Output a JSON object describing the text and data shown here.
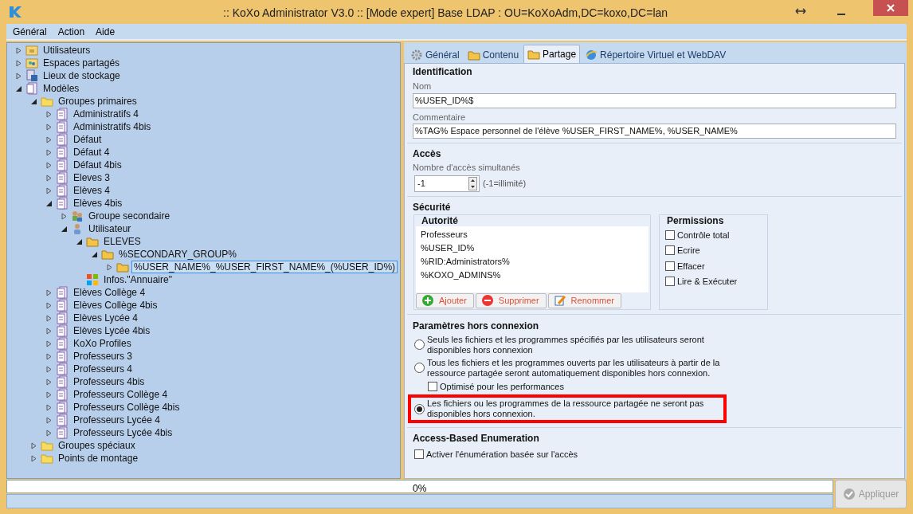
{
  "window": {
    "title": ":: KoXo Administrator V3.0 :: [Mode expert] Base LDAP : OU=KoXoAdm,DC=koxo,DC=lan"
  },
  "menu": [
    "Général",
    "Action",
    "Aide"
  ],
  "tree": [
    {
      "label": "Utilisateurs",
      "kind": "users",
      "expanded": false,
      "selected": false
    },
    {
      "label": "Espaces partagés",
      "kind": "shared",
      "expanded": false,
      "selected": false
    },
    {
      "label": "Lieux de stockage",
      "kind": "storage",
      "expanded": false,
      "selected": false
    },
    {
      "label": "Modèles",
      "kind": "models",
      "expanded": true,
      "selected": false,
      "children": [
        {
          "label": "Groupes primaires",
          "kind": "folder",
          "expanded": true,
          "selected": false,
          "children": [
            {
              "label": "Administratifs 4",
              "kind": "template",
              "expanded": false,
              "selected": false
            },
            {
              "label": "Administratifs 4bis",
              "kind": "template",
              "expanded": false,
              "selected": false
            },
            {
              "label": "Défaut",
              "kind": "template",
              "expanded": false,
              "selected": false
            },
            {
              "label": "Défaut 4",
              "kind": "template",
              "expanded": false,
              "selected": false
            },
            {
              "label": "Défaut 4bis",
              "kind": "template",
              "expanded": false,
              "selected": false
            },
            {
              "label": "Eleves 3",
              "kind": "template",
              "expanded": false,
              "selected": false
            },
            {
              "label": "Elèves 4",
              "kind": "template",
              "expanded": false,
              "selected": false
            },
            {
              "label": "Elèves 4bis",
              "kind": "template",
              "expanded": true,
              "selected": false,
              "children": [
                {
                  "label": "Groupe secondaire",
                  "kind": "group",
                  "expanded": false,
                  "selected": false
                },
                {
                  "label": "Utilisateur",
                  "kind": "user",
                  "expanded": true,
                  "selected": false,
                  "children": [
                    {
                      "label": "ELEVES",
                      "kind": "folder2",
                      "expanded": true,
                      "selected": false,
                      "children": [
                        {
                          "label": "%SECONDARY_GROUP%",
                          "kind": "folder2",
                          "expanded": true,
                          "selected": false,
                          "children": [
                            {
                              "label": "%USER_NAME%_%USER_FIRST_NAME%_(%USER_ID%)",
                              "kind": "folder2",
                              "expanded": false,
                              "selected": true
                            }
                          ]
                        }
                      ]
                    },
                    {
                      "label": "Infos.\"Annuaire\"",
                      "kind": "windows",
                      "selected": false
                    }
                  ]
                }
              ]
            },
            {
              "label": "Elèves Collège 4",
              "kind": "template",
              "expanded": false,
              "selected": false
            },
            {
              "label": "Elèves Collège 4bis",
              "kind": "template",
              "expanded": false,
              "selected": false
            },
            {
              "label": "Elèves Lycée 4",
              "kind": "template",
              "expanded": false,
              "selected": false
            },
            {
              "label": "Elèves Lycée 4bis",
              "kind": "template",
              "expanded": false,
              "selected": false
            },
            {
              "label": "KoXo Profiles",
              "kind": "template",
              "expanded": false,
              "selected": false
            },
            {
              "label": "Professeurs 3",
              "kind": "template",
              "expanded": false,
              "selected": false
            },
            {
              "label": "Professeurs 4",
              "kind": "template",
              "expanded": false,
              "selected": false
            },
            {
              "label": "Professeurs 4bis",
              "kind": "template",
              "expanded": false,
              "selected": false
            },
            {
              "label": "Professeurs Collège 4",
              "kind": "template",
              "expanded": false,
              "selected": false
            },
            {
              "label": "Professeurs Collège 4bis",
              "kind": "template",
              "expanded": false,
              "selected": false
            },
            {
              "label": "Professeurs Lycée 4",
              "kind": "template",
              "expanded": false,
              "selected": false
            },
            {
              "label": "Professeurs Lycée 4bis",
              "kind": "template",
              "expanded": false,
              "selected": false
            }
          ]
        },
        {
          "label": "Groupes spéciaux",
          "kind": "folder",
          "expanded": false,
          "selected": false
        },
        {
          "label": "Points de montage",
          "kind": "folder",
          "expanded": false,
          "selected": false
        }
      ]
    }
  ],
  "tabs": [
    {
      "label": "Général",
      "kind": "gear",
      "selected": false
    },
    {
      "label": "Contenu",
      "kind": "folder",
      "selected": false
    },
    {
      "label": "Partage",
      "kind": "folder",
      "selected": true
    },
    {
      "label": "Répertoire Virtuel et WebDAV",
      "kind": "globe",
      "selected": false
    }
  ],
  "identification": {
    "title": "Identification",
    "name_label": "Nom",
    "name_value": "%USER_ID%$",
    "comment_label": "Commentaire",
    "comment_value": "%TAG% Espace personnel de l'élève %USER_FIRST_NAME%, %USER_NAME%"
  },
  "access": {
    "title": "Accès",
    "label": "Nombre d'accès simultanés",
    "value": "-1",
    "hint": "(-1=illimité)"
  },
  "security": {
    "title": "Sécurité",
    "authority_title": "Autorité",
    "authorities": [
      "Professeurs",
      "%USER_ID%",
      "%RID:Administrators%",
      "%KOXO_ADMINS%"
    ],
    "buttons": [
      {
        "label": "Ajouter",
        "kind": "add"
      },
      {
        "label": "Supprimer",
        "kind": "remove"
      },
      {
        "label": "Renommer",
        "kind": "rename"
      }
    ],
    "permissions_title": "Permissions",
    "permissions": [
      {
        "label": "Contrôle total",
        "checked": false
      },
      {
        "label": "Ecrire",
        "checked": false
      },
      {
        "label": "Effacer",
        "checked": false
      },
      {
        "label": "Lire & Exécuter",
        "checked": false
      }
    ]
  },
  "offline": {
    "title": "Paramètres hors connexion",
    "options": [
      {
        "label": "Seuls les fichiers et les programmes spécifiés par les utilisateurs seront disponibles hors connexion",
        "selected": false,
        "highlighted": false
      },
      {
        "label": "Tous les fichiers et les programmes ouverts par les utilisateurs à partir de la ressource partagée seront automatiquement disponibles hors connexion.",
        "selected": false,
        "highlighted": false,
        "sub_option": {
          "label": "Optimisé pour les performances",
          "checked": false
        }
      },
      {
        "label": "Les fichiers ou les programmes de la ressource partagée ne seront pas disponibles hors connexion.",
        "selected": true,
        "highlighted": true
      }
    ]
  },
  "abe": {
    "title": "Access-Based Enumeration",
    "label": "Activer l'énumération basée sur l'accès",
    "checked": false
  },
  "status_bar": {
    "progress_text": "0%",
    "level": 0,
    "apply_button": {
      "label": "Appliquer",
      "disabled": true
    }
  }
}
